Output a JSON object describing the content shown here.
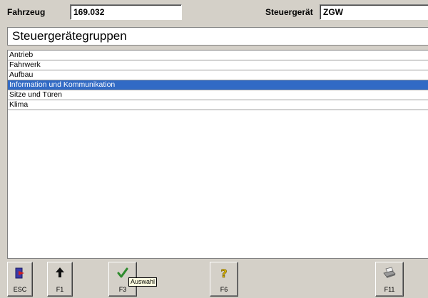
{
  "header": {
    "vehicle_label": "Fahrzeug",
    "vehicle_value": "169.032",
    "ecu_label": "Steuergerät",
    "ecu_value": "ZGW"
  },
  "title": "Steuergerätegruppen",
  "groups": [
    {
      "label": "Antrieb",
      "selected": false
    },
    {
      "label": "Fahrwerk",
      "selected": false
    },
    {
      "label": "Aufbau",
      "selected": false
    },
    {
      "label": "Information und Kommunikation",
      "selected": true
    },
    {
      "label": "Sitze und Türen",
      "selected": false
    },
    {
      "label": "Klima",
      "selected": false
    }
  ],
  "toolbar": {
    "buttons": [
      {
        "key": "ESC",
        "icon": "exit-door-icon"
      },
      {
        "key": "F1",
        "icon": "arrow-up-icon"
      },
      {
        "key": "F3",
        "icon": "checkmark-icon"
      },
      {
        "key": "F6",
        "icon": "help-question-icon"
      },
      {
        "key": "F11",
        "icon": "printer-icon"
      }
    ],
    "tooltip": "Auswahl"
  },
  "colors": {
    "selection": "#316ac5",
    "panel": "#d4d0c8",
    "checkmark": "#2e8b2e",
    "help": "#d8b400"
  }
}
